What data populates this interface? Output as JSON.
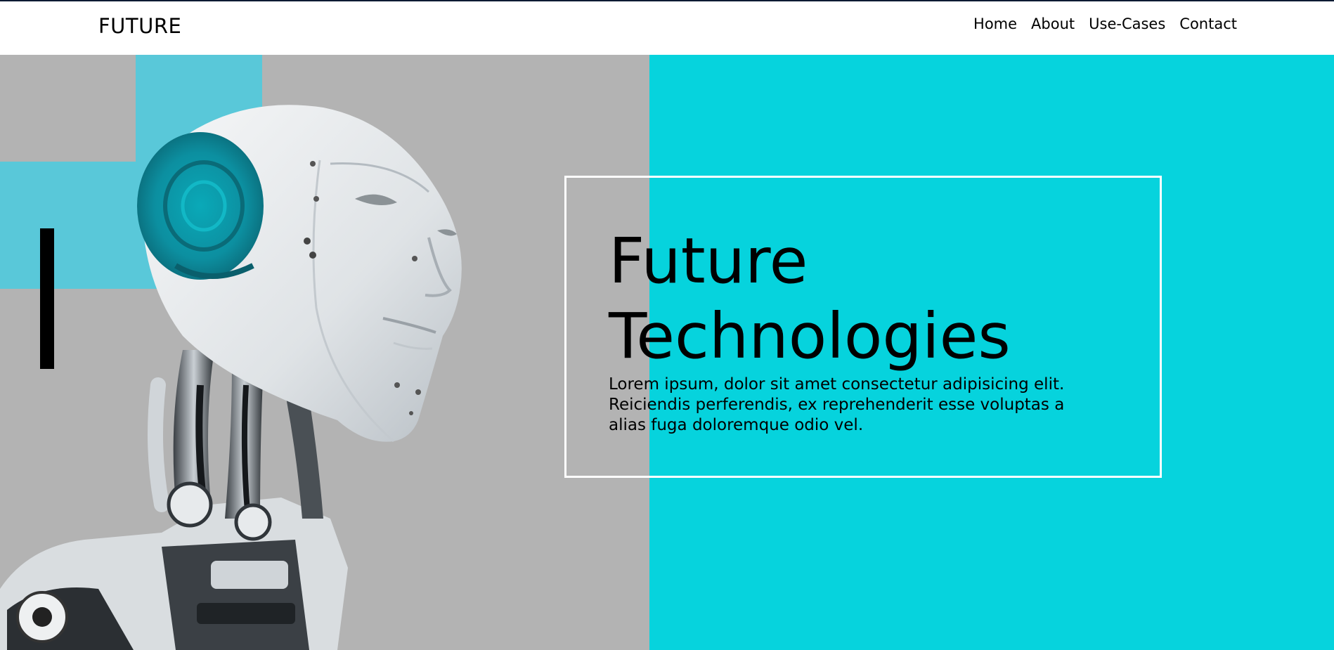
{
  "nav": {
    "brand": "FUTURE",
    "links": [
      "Home",
      "About",
      "Use-Cases",
      "Contact"
    ]
  },
  "hero": {
    "title": "Future Technologies",
    "description": "Lorem ipsum, dolor sit amet consectetur adipisicing elit. Reiciendis perferendis, ex reprehenderit esse voluptas a alias fuga doloremque odio vel."
  },
  "colors": {
    "nav_background": "#ffffff",
    "left_panel": "#b3b3b3",
    "right_panel": "#06d3dd",
    "accent_block": "#59c8d9",
    "frame_border": "#ffffff",
    "text": "#000000"
  },
  "images": {
    "hero_image": "robot-head-image"
  }
}
